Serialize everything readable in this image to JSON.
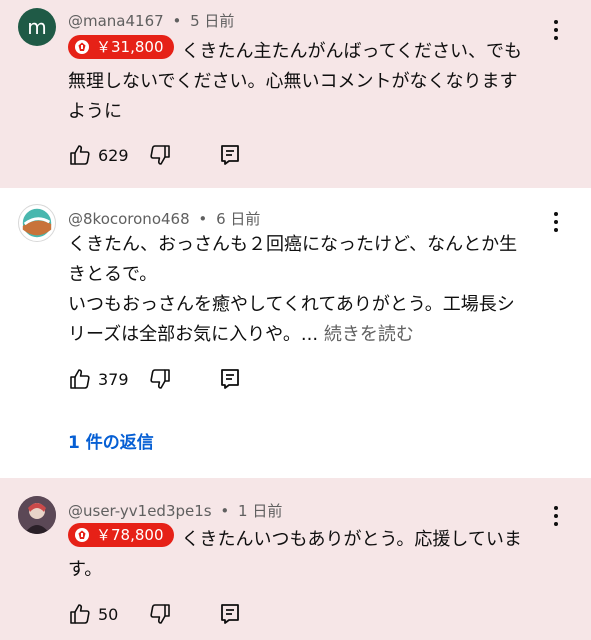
{
  "comments": [
    {
      "avatar_letter": "m",
      "author": "@mana4167",
      "separator": "•",
      "time": "5 日前",
      "superchat": "￥31,800",
      "lines": [
        "くきたん主たんがんばってください、でも",
        "無理しないでください。心無いコメントがなくなります",
        "ように"
      ],
      "likes": "629"
    },
    {
      "author": "@8kocorono468",
      "separator": "•",
      "time": "6 日前",
      "lines": [
        "くきたん、おっさんも２回癌になったけど、なんとか生",
        "きとるで。",
        "いつもおっさんを癒やしてくれてありがとう。工場長シ",
        "リーズは全部お気に入りや。..."
      ],
      "read_more": "続きを読む",
      "likes": "379",
      "replies_label": "1 件の返信"
    },
    {
      "author": "@user-yv1ed3pe1s",
      "separator": "•",
      "time": "1 日前",
      "superchat": "￥78,800",
      "lines": [
        "くきたんいつもありがとう。応援していま",
        "す。"
      ],
      "likes": "50"
    }
  ],
  "colors": {
    "highlight_bg": "#f6e6e7",
    "superchat_red": "#e62117",
    "link_blue": "#065fd4",
    "meta_gray": "#606060"
  },
  "icons": [
    "thumb-up-icon",
    "thumb-down-icon",
    "reply-icon",
    "more-vert-icon",
    "superchat-icon"
  ]
}
